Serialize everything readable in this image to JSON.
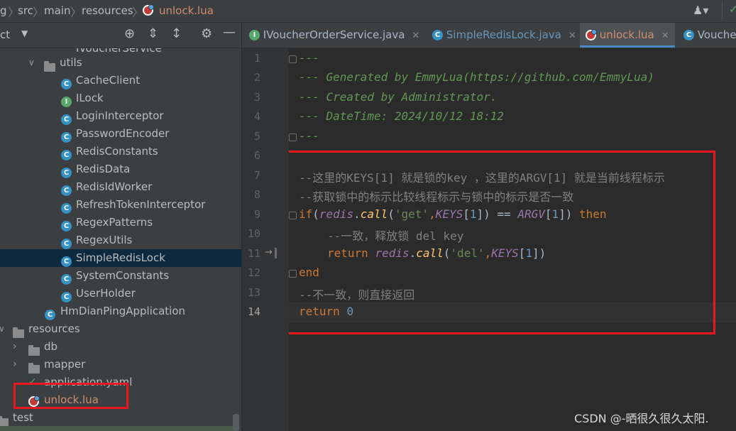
{
  "breadcrumb": {
    "partial_left": "g",
    "items": [
      "src",
      "main",
      "resources"
    ],
    "current_file": "unlock.lua"
  },
  "project_panel": {
    "title_partial": "ct"
  },
  "tabs": [
    {
      "label": "IVoucherOrderService.java",
      "icon": "interface-icon"
    },
    {
      "label": "SimpleRedisLock.java",
      "icon": "class-icon"
    },
    {
      "label": "unlock.lua",
      "icon": "lua-icon",
      "active": true
    },
    {
      "label": "Vouche",
      "icon": "class-icon"
    }
  ],
  "tree": {
    "partial_top": "IVoucherService",
    "utils_folder": "utils",
    "utils_items": [
      {
        "label": "CacheClient",
        "kind": "class"
      },
      {
        "label": "ILock",
        "kind": "interface"
      },
      {
        "label": "LoginInterceptor",
        "kind": "class"
      },
      {
        "label": "PasswordEncoder",
        "kind": "class"
      },
      {
        "label": "RedisConstants",
        "kind": "class"
      },
      {
        "label": "RedisData",
        "kind": "class"
      },
      {
        "label": "RedisIdWorker",
        "kind": "class"
      },
      {
        "label": "RefreshTokenInterceptor",
        "kind": "class"
      },
      {
        "label": "RegexPatterns",
        "kind": "class"
      },
      {
        "label": "RegexUtils",
        "kind": "class"
      },
      {
        "label": "SimpleRedisLock",
        "kind": "class",
        "selected": true
      },
      {
        "label": "SystemConstants",
        "kind": "class"
      },
      {
        "label": "UserHolder",
        "kind": "class"
      }
    ],
    "app_class": "HmDianPingApplication",
    "resources_folder": "resources",
    "db_folder": "db",
    "mapper_folder": "mapper",
    "application_yaml": "application.yaml",
    "unlock_file": "unlock.lua",
    "test_folder": "test"
  },
  "editor": {
    "line_numbers": [
      "1",
      "2",
      "3",
      "4",
      "5",
      "6",
      "7",
      "8",
      "9",
      "10",
      "11",
      "12",
      "13",
      "14"
    ],
    "line1": "---",
    "line2": "--- Generated by EmmyLua(https://github.com/EmmyLua)",
    "line3": "--- Created by Administrator.",
    "line4": "--- DateTime: 2024/10/12 18:12",
    "line5": "---",
    "line7": "--这里的KEYS[1] 就是锁的key ，这里的ARGV[1] 就是当前线程标示",
    "line8": "--获取锁中的标示比较线程标示与锁中的标示是否一致",
    "line9": {
      "kw_if": "if",
      "p1": "(",
      "redis": "redis",
      "dot": ".",
      "call": "call",
      "p2": "(",
      "get": "'get'",
      "comma": ",",
      "keys": "KEYS",
      "idx": "[",
      "one": "1",
      "rest": "]) == ",
      "argv": "ARGV",
      "idx2": "[",
      "one2": "1",
      "close": "]) ",
      "then": "then"
    },
    "line10": "--一致，释放锁 del key",
    "line11": {
      "kw_return": "return",
      "redis": "redis",
      "dot": ".",
      "call": "call",
      "p": "(",
      "del": "'del'",
      "comma": ",",
      "keys": "KEYS",
      "idx": "[",
      "one": "1",
      "close": "])"
    },
    "line12": "end",
    "line13": "--不一致，则直接返回",
    "line14": {
      "kw_return": "return",
      "zero": "0"
    }
  },
  "watermark": "CSDN @-晒很久很久太阳."
}
